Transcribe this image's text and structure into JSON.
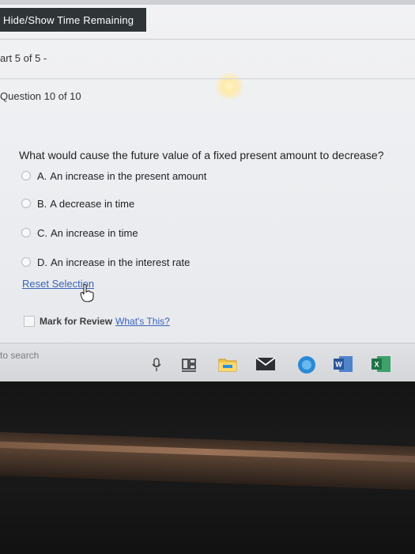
{
  "timer": {
    "toggle_label": "Hide/Show Time Remaining"
  },
  "quiz": {
    "part_label": "art 5 of 5 -",
    "question_label": "Question 10 of 10",
    "question_text": "What would cause the future value of a fixed present amount to decrease?",
    "options": [
      {
        "letter": "A.",
        "text": "An increase in the present amount"
      },
      {
        "letter": "B.",
        "text": "A decrease in time"
      },
      {
        "letter": "C.",
        "text": "An increase in time"
      },
      {
        "letter": "D.",
        "text": "An increase in the interest rate"
      }
    ],
    "reset_label": "Reset Selection",
    "mark_review_label": "Mark for Review",
    "whats_this_label": "What's This?"
  },
  "taskbar": {
    "search_placeholder": "to search",
    "icons": [
      "microphone-icon",
      "task-view-icon",
      "file-explorer-icon",
      "mail-icon",
      "chrome-icon",
      "word-icon",
      "excel-icon"
    ],
    "colors": {
      "word": "#2b579a",
      "excel": "#217346",
      "explorer": "#f5c342",
      "accent": "#3a63b8"
    }
  }
}
